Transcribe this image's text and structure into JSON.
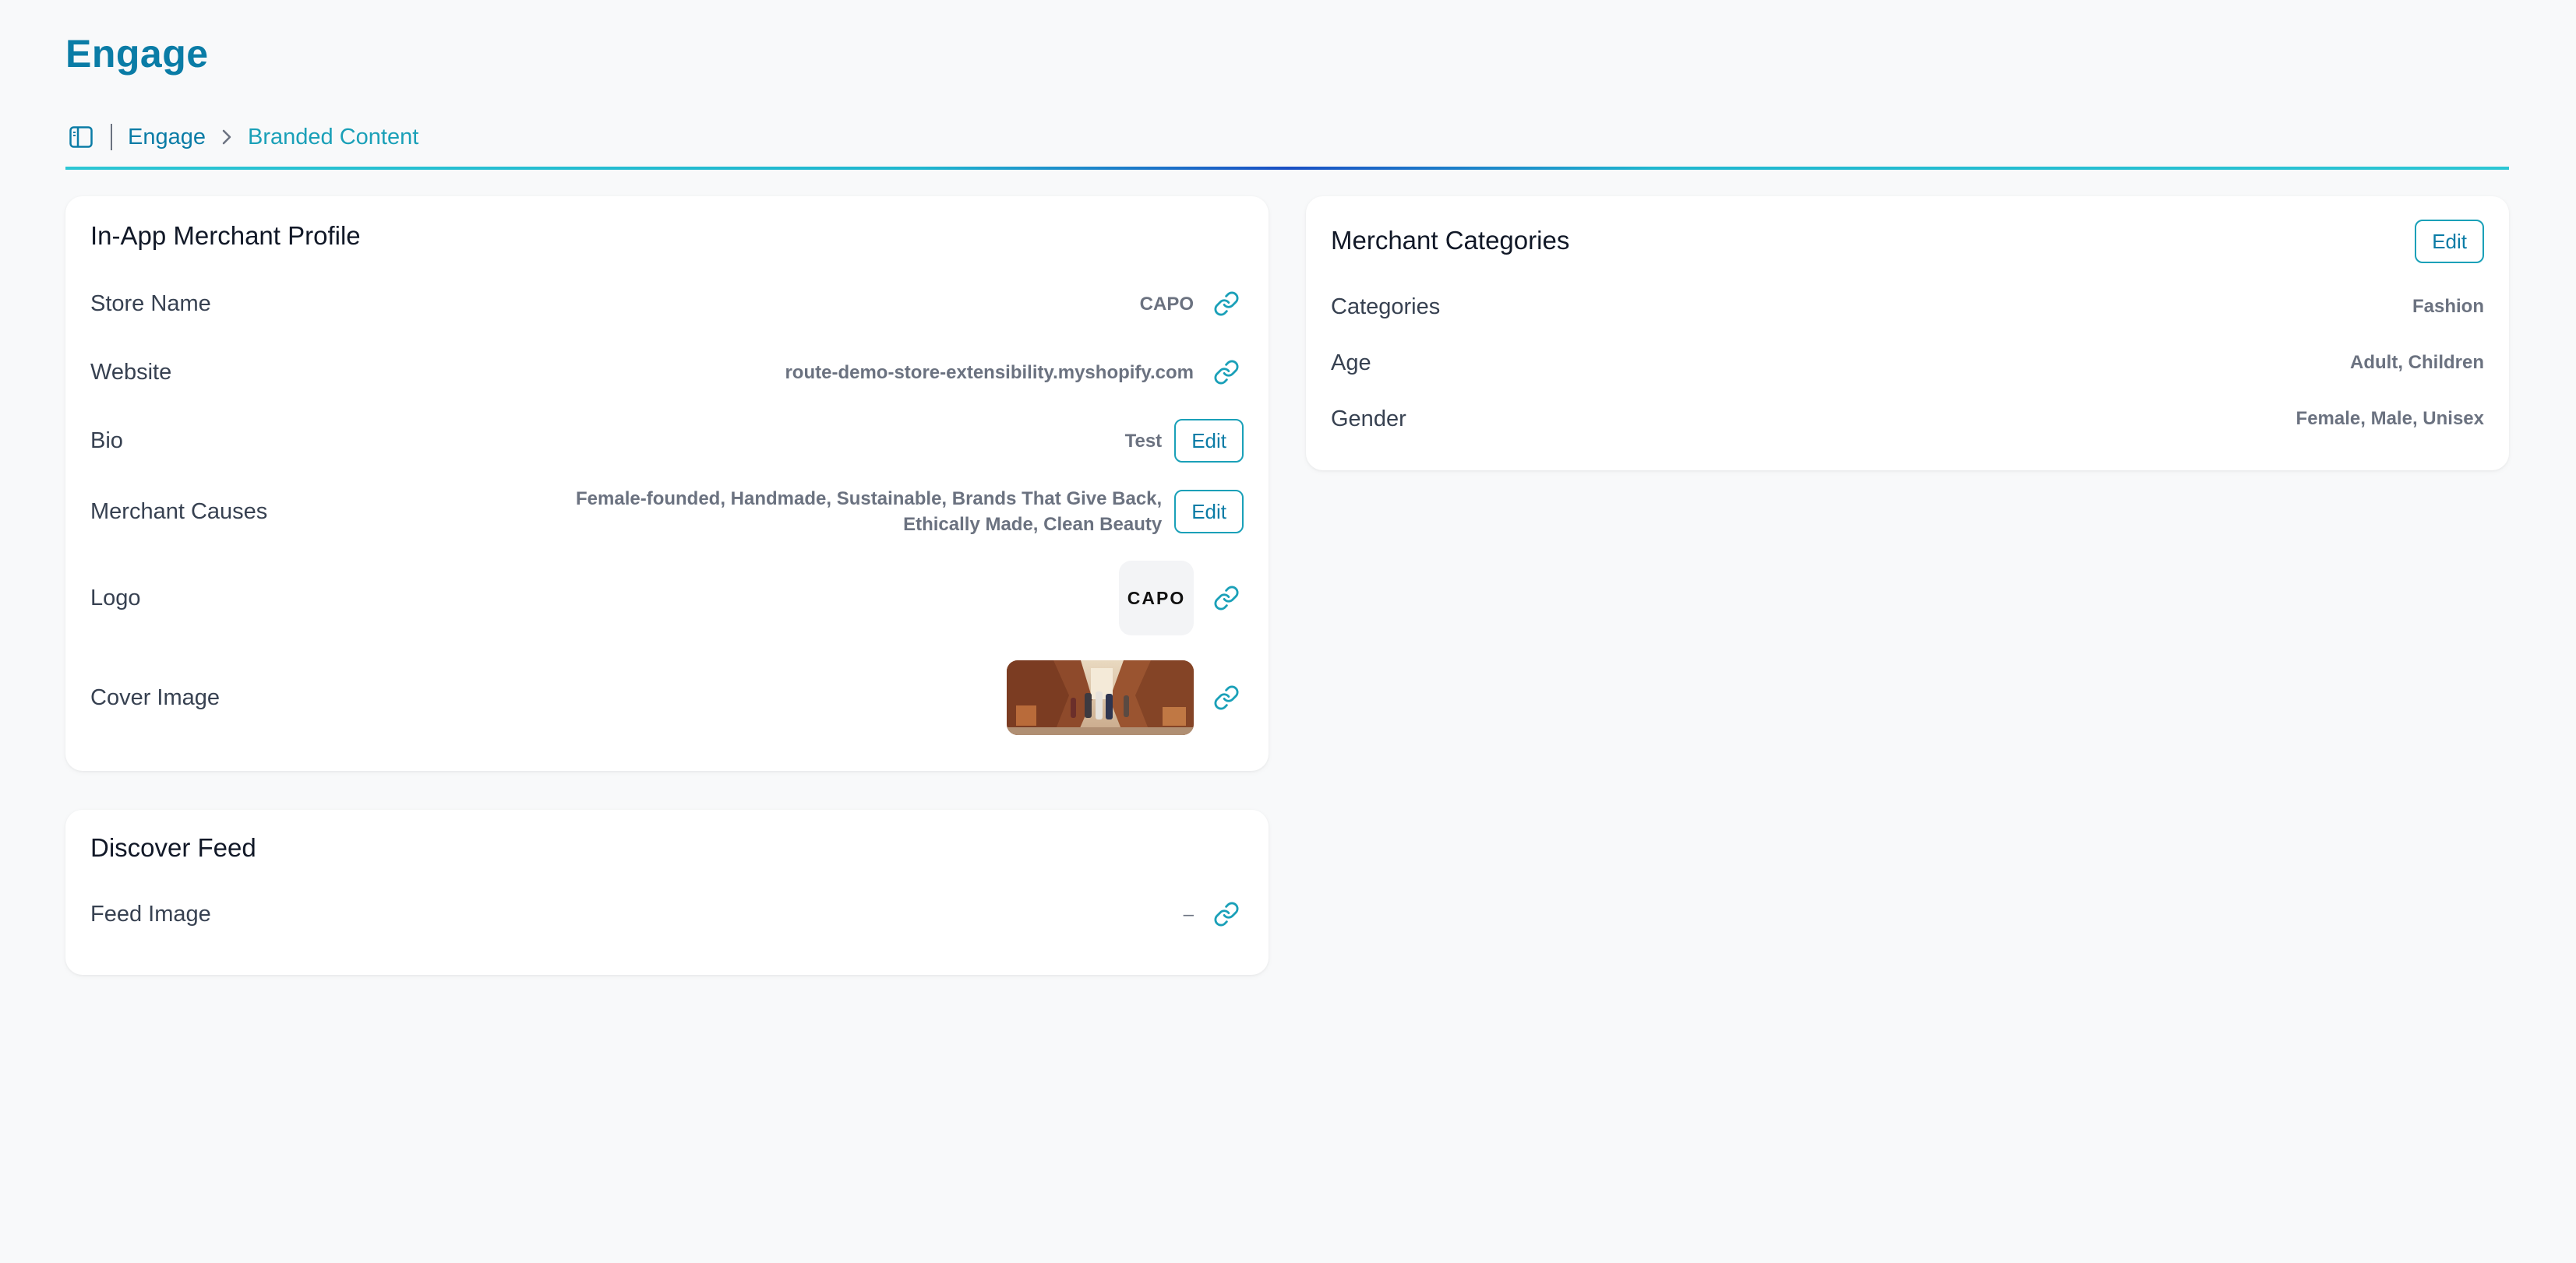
{
  "header": {
    "title": "Engage"
  },
  "breadcrumb": {
    "items": [
      "Engage",
      "Branded Content"
    ]
  },
  "profile_card": {
    "title": "In-App Merchant Profile",
    "rows": [
      {
        "label": "Store Name",
        "value": "CAPO"
      },
      {
        "label": "Website",
        "value": "route-demo-store-extensibility.myshopify.com"
      },
      {
        "label": "Bio",
        "value": "Test",
        "action": "Edit"
      },
      {
        "label": "Merchant Causes",
        "value_line1": "Female-founded, Handmade, Sustainable, Brands That Give Back,",
        "value_line2": "Ethically Made, Clean Beauty",
        "action": "Edit"
      },
      {
        "label": "Logo",
        "logo_text": "CAPO"
      },
      {
        "label": "Cover Image"
      }
    ]
  },
  "discover_card": {
    "title": "Discover Feed",
    "rows": [
      {
        "label": "Feed Image",
        "value": "–"
      }
    ]
  },
  "categories_card": {
    "title": "Merchant Categories",
    "edit_label": "Edit",
    "rows": [
      {
        "label": "Categories",
        "value": "Fashion"
      },
      {
        "label": "Age",
        "value": "Adult, Children"
      },
      {
        "label": "Gender",
        "value": "Female, Male, Unisex"
      }
    ]
  },
  "colors": {
    "accent": "#0a7ca6",
    "accent_light": "#1aa0b8",
    "background": "#f8f9fa",
    "card": "#ffffff"
  },
  "icons": {
    "sidebar_toggle": "sidebar-panel-icon",
    "breadcrumb_separator": "chevron-right-icon",
    "link": "link-chain-icon"
  }
}
